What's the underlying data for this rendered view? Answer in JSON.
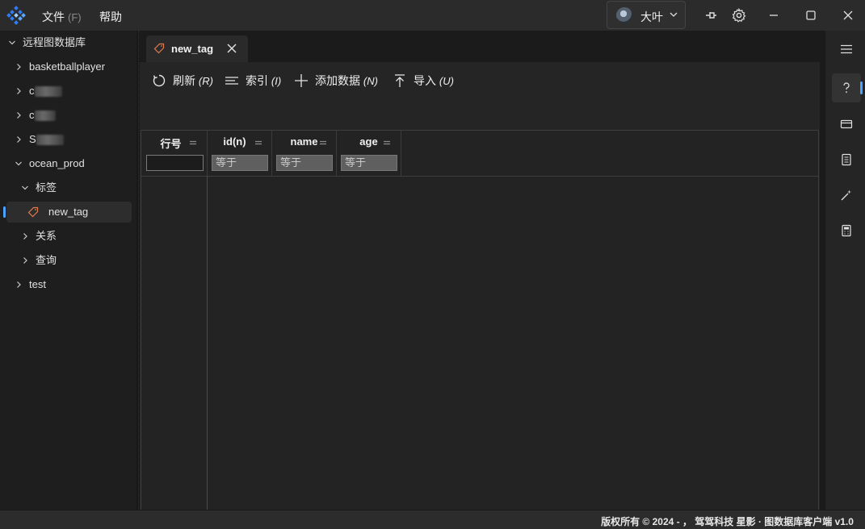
{
  "titlebar": {
    "menu_file": "文件",
    "menu_file_accel": "(F)",
    "menu_help": "帮助",
    "user_name": "大叶"
  },
  "sidebar": {
    "root": "远程图数据库",
    "items": [
      {
        "label": "basketballplayer"
      },
      {
        "label": "c"
      },
      {
        "label": "c"
      },
      {
        "label": "S"
      },
      {
        "label": "ocean_prod"
      },
      {
        "label": "标签"
      },
      {
        "label": "new_tag"
      },
      {
        "label": "关系"
      },
      {
        "label": "查询"
      },
      {
        "label": "test"
      }
    ]
  },
  "tab": {
    "label": "new_tag"
  },
  "toolbar": {
    "refresh": "刷新",
    "refresh_acc": "(R)",
    "index": "索引",
    "index_acc": "(I)",
    "add": "添加数据",
    "add_acc": "(N)",
    "import": "导入",
    "import_acc": "(U)"
  },
  "table": {
    "columns": [
      {
        "label": "行号",
        "filter": ""
      },
      {
        "label": "id(n)",
        "filter": "等于"
      },
      {
        "label": "name",
        "filter": "等于"
      },
      {
        "label": "age",
        "filter": "等于"
      }
    ]
  },
  "statusbar": {
    "text": "版权所有 © 2024 - ， 驾驾科技 星影 · 图数据库客户端 v1.0"
  },
  "colors": {
    "accent": "#4aa3ff",
    "tag_icon": "#e07a4f"
  },
  "icons": [
    "app-logo-icon",
    "chevron-down-icon",
    "pin-icon",
    "gear-icon",
    "minimize-icon",
    "maximize-icon",
    "close-icon",
    "tag-icon",
    "refresh-icon",
    "index-icon",
    "plus-icon",
    "import-icon",
    "hamburger-icon",
    "help-icon",
    "card-icon",
    "list-icon",
    "magic-wand-icon",
    "calculator-icon"
  ]
}
